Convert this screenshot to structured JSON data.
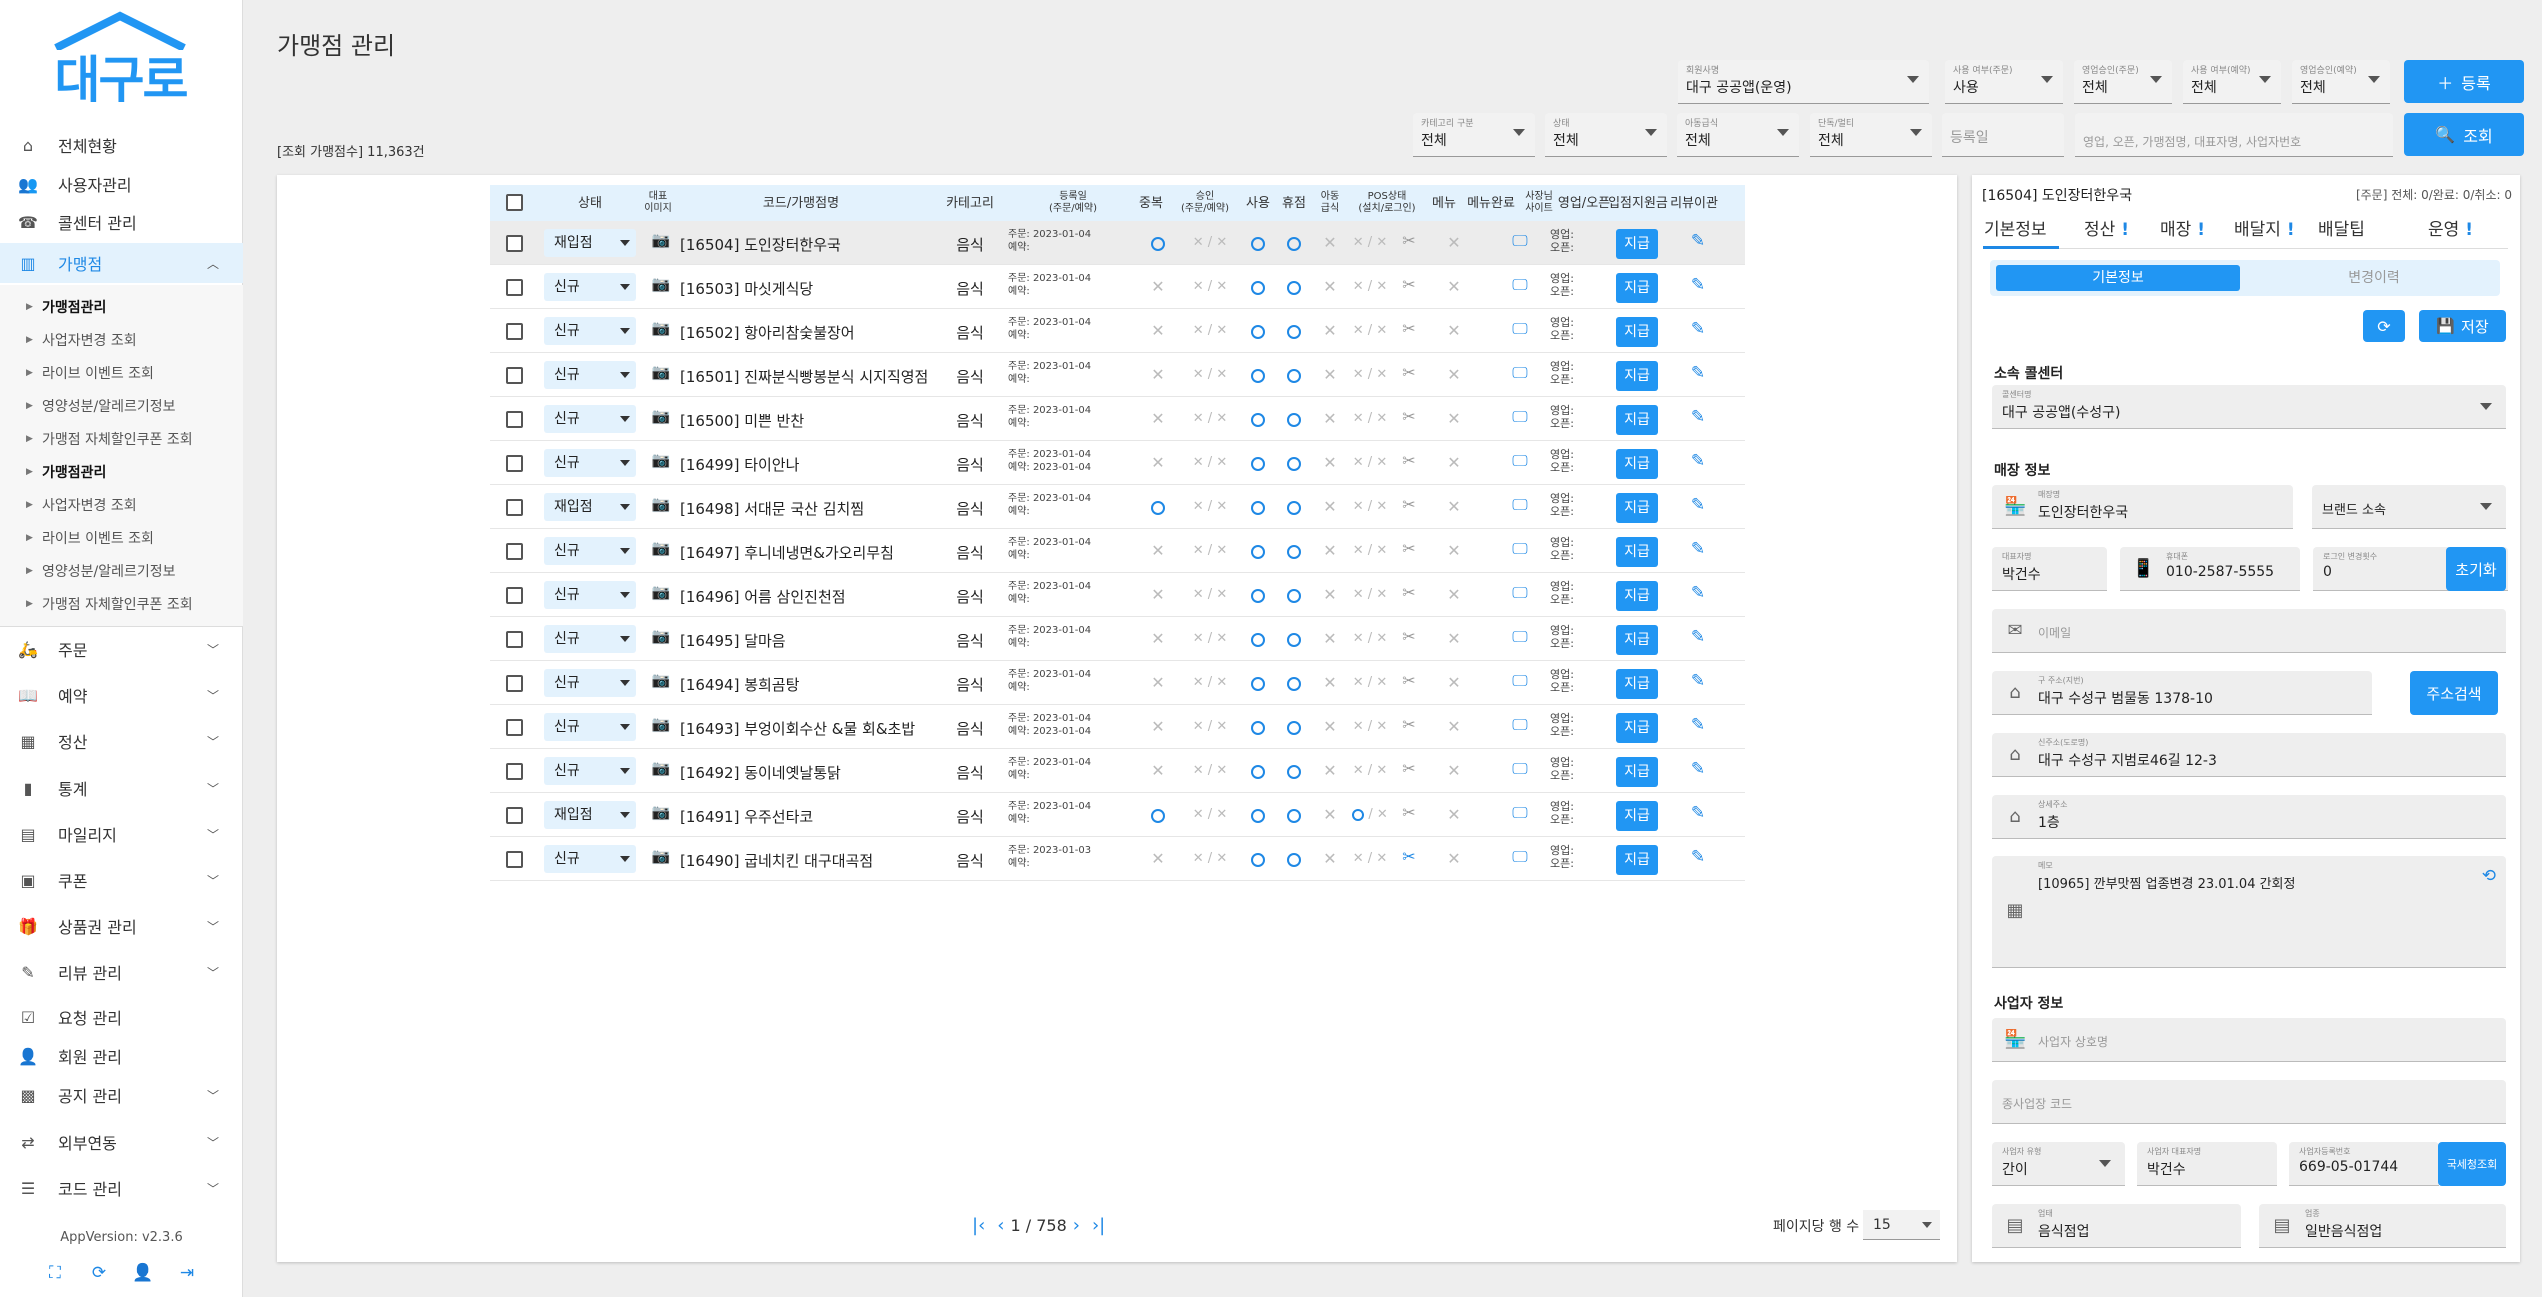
{
  "brand": {
    "logo_text": "대구로"
  },
  "sidebar": {
    "items": [
      {
        "label": "전체현황",
        "icon": "home-icon"
      },
      {
        "label": "사용자관리",
        "icon": "users-icon"
      },
      {
        "label": "콜센터 관리",
        "icon": "headset-icon"
      },
      {
        "label": "가맹점",
        "icon": "store-icon"
      },
      {
        "label": "주문",
        "icon": "order-icon"
      },
      {
        "label": "예약",
        "icon": "book-icon"
      },
      {
        "label": "정산",
        "icon": "calc-icon"
      },
      {
        "label": "통계",
        "icon": "chart-icon"
      },
      {
        "label": "마일리지",
        "icon": "mileage-icon"
      },
      {
        "label": "쿠폰",
        "icon": "coupon-icon"
      },
      {
        "label": "상품권 관리",
        "icon": "gift-icon"
      },
      {
        "label": "리뷰 관리",
        "icon": "review-icon"
      },
      {
        "label": "요청 관리",
        "icon": "request-icon"
      },
      {
        "label": "회원 관리",
        "icon": "member-icon"
      },
      {
        "label": "공지 관리",
        "icon": "notice-icon"
      },
      {
        "label": "외부연동",
        "icon": "link-icon"
      },
      {
        "label": "코드 관리",
        "icon": "code-icon"
      }
    ],
    "sub": [
      "가맹점관리",
      "사업자변경 조회",
      "라이브 이벤트 조회",
      "영양성분/알레르기정보",
      "가맹점 자체할인쿠폰 조회",
      "가맹점관리",
      "사업자변경 조회",
      "라이브 이벤트 조회",
      "영양성분/알레르기정보",
      "가맹점 자체할인쿠폰 조회"
    ],
    "version": "AppVersion: v2.3.6"
  },
  "header": {
    "title": "가맹점 관리",
    "count_label": "[조회 가맹점수] 11,363건"
  },
  "filters": {
    "callcenter": {
      "label": "회원사명",
      "value": "대구 공공앱(운영)"
    },
    "use_order": {
      "label": "사용 여부(주문)",
      "value": "사용"
    },
    "sales_order": {
      "label": "영업승인(주문)",
      "value": "전체"
    },
    "use_reserve": {
      "label": "사용 여부(예약)",
      "value": "전체"
    },
    "sales_reserve": {
      "label": "영업승인(예약)",
      "value": "전체"
    },
    "register_btn": "등록",
    "category": {
      "label": "카테고리 구분",
      "value": "전체"
    },
    "status": {
      "label": "상태",
      "value": "전체"
    },
    "child_meal": {
      "label": "아동급식",
      "value": "전체"
    },
    "group": {
      "label": "단독/멀티",
      "value": "전체"
    },
    "reg_date": {
      "placeholder": "등록일"
    },
    "keyword": {
      "placeholder": "영업, 오픈, 가맹점명, 대표자명, 사업자번호"
    },
    "search_btn": "조회"
  },
  "table": {
    "headers": [
      "상태",
      "대표\n이미지",
      "코드/가맹점명",
      "카테고리",
      "등록일\n(주문/예약)",
      "중복",
      "승인\n(주문/예약)",
      "사용",
      "휴점",
      "아동\n급식",
      "POS상태\n(설치/로그인)",
      "메뉴",
      "메뉴완료",
      "사장님\n사이트",
      "영업/오픈",
      "입점지원금",
      "리뷰이관"
    ],
    "rows": [
      {
        "status": "재입점",
        "name": "[16504] 도인장터한우국",
        "cat": "음식",
        "d1": "주문: 2023-01-04",
        "d2": "예약:",
        "dup": true,
        "pos": "x"
      },
      {
        "status": "신규",
        "name": "[16503] 마싯게식당",
        "cat": "음식",
        "d1": "주문: 2023-01-04",
        "d2": "예약:",
        "dup": false,
        "pos": "x"
      },
      {
        "status": "신규",
        "name": "[16502] 항아리참숯불장어",
        "cat": "음식",
        "d1": "주문: 2023-01-04",
        "d2": "예약:",
        "dup": false,
        "pos": "x"
      },
      {
        "status": "신규",
        "name": "[16501] 진짜분식빵봉분식 시지직영점",
        "cat": "음식",
        "d1": "주문: 2023-01-04",
        "d2": "예약:",
        "dup": false,
        "pos": "x"
      },
      {
        "status": "신규",
        "name": "[16500] 미쁜 반찬",
        "cat": "음식",
        "d1": "주문: 2023-01-04",
        "d2": "예약:",
        "dup": false,
        "pos": "x"
      },
      {
        "status": "신규",
        "name": "[16499] 타이안나",
        "cat": "음식",
        "d1": "주문: 2023-01-04",
        "d2": "예약: 2023-01-04",
        "dup": false,
        "pos": "x"
      },
      {
        "status": "재입점",
        "name": "[16498] 서대문 국산 김치찜",
        "cat": "음식",
        "d1": "주문: 2023-01-04",
        "d2": "예약:",
        "dup": true,
        "pos": "x"
      },
      {
        "status": "신규",
        "name": "[16497] 후니네냉면&가오리무침",
        "cat": "음식",
        "d1": "주문: 2023-01-04",
        "d2": "예약:",
        "dup": false,
        "pos": "x"
      },
      {
        "status": "신규",
        "name": "[16496] 어름 삼인진천점",
        "cat": "음식",
        "d1": "주문: 2023-01-04",
        "d2": "예약:",
        "dup": false,
        "pos": "x"
      },
      {
        "status": "신규",
        "name": "[16495] 달마음",
        "cat": "음식",
        "d1": "주문: 2023-01-04",
        "d2": "예약:",
        "dup": false,
        "pos": "x"
      },
      {
        "status": "신규",
        "name": "[16494] 봉희곰탕",
        "cat": "음식",
        "d1": "주문: 2023-01-04",
        "d2": "예약:",
        "dup": false,
        "pos": "x"
      },
      {
        "status": "신규",
        "name": "[16493] 부엉이회수산 &물 회&초밥",
        "cat": "음식",
        "d1": "주문: 2023-01-04",
        "d2": "예약: 2023-01-04",
        "dup": false,
        "pos": "x"
      },
      {
        "status": "신규",
        "name": "[16492] 동이네옛날통닭",
        "cat": "음식",
        "d1": "주문: 2023-01-04",
        "d2": "예약:",
        "dup": false,
        "pos": "x"
      },
      {
        "status": "재입점",
        "name": "[16491] 우주선타코",
        "cat": "음식",
        "d1": "주문: 2023-01-04",
        "d2": "예약:",
        "dup": true,
        "pos": "o"
      },
      {
        "status": "신규",
        "name": "[16490] 굽네치킨 대구대곡점",
        "cat": "음식",
        "d1": "주문: 2023-01-03",
        "d2": "예약:",
        "dup": false,
        "pos": "x",
        "menu_done": true
      }
    ],
    "cell_labels": {
      "x": "✕",
      "slash": "✕ / ✕",
      "biz_a": "영업:",
      "biz_b": "오픈:",
      "support_btn": "지급"
    }
  },
  "pager": {
    "text": "1 / 758",
    "rows_per_page_label": "페이지당 행 수 :",
    "rows_per_page": "15"
  },
  "detail": {
    "title": "[16504] 도인장터한우국",
    "summary": "[주문] 전체: 0/완료: 0/취소: 0",
    "tabs": [
      "기본정보",
      "정산",
      "매장",
      "배달지",
      "배달팁",
      "운영"
    ],
    "tab_marks": [
      "",
      "!",
      "!",
      "!",
      "",
      "!"
    ],
    "seg_on": "기본정보",
    "seg_off": "변경이력",
    "save_btn": "저장",
    "sec_center": "소속 콜센터",
    "center": {
      "label": "콜센터명",
      "value": "대구 공공앱(수성구)"
    },
    "sec_store": "매장 정보",
    "store_name": {
      "label": "매장명",
      "value": "도인장터한우국"
    },
    "brand": {
      "value": "브랜드 소속"
    },
    "owner": {
      "label": "대표자명",
      "value": "박건수"
    },
    "phone": {
      "label": "휴대폰",
      "value": "010-2587-5555"
    },
    "pw_count": {
      "label": "로그인 변경횟수",
      "value": "0"
    },
    "init_btn": "초기화",
    "email": {
      "placeholder": "이메일"
    },
    "addr_old": {
      "label": "구 주소(지번)",
      "value": "대구 수성구 범물동 1378-10"
    },
    "addr_btn": "주소검색",
    "addr_new": {
      "label": "신주소(도로명)",
      "value": "대구 수성구 지범로46길 12-3"
    },
    "addr_detail": {
      "label": "상세주소",
      "value": "1층"
    },
    "memo": {
      "label": "메모",
      "value": "[10965] 깐부맛찜 업종변경 23.01.04 간회정"
    },
    "sec_biz": "사업자 정보",
    "biz_name": {
      "placeholder": "사업자 상호명"
    },
    "biz_code": {
      "placeholder": "종사업장 코드"
    },
    "biz_type": {
      "label": "사업자 유형",
      "value": "간이"
    },
    "biz_owner": {
      "label": "사업자 대표자명",
      "value": "박건수"
    },
    "biz_no": {
      "label": "사업자등록번호",
      "value": "669-05-01744"
    },
    "tax_btn": "국세청조회",
    "biz_kind": {
      "label": "업태",
      "value": "음식점업"
    },
    "biz_item": {
      "label": "업종",
      "value": "일반음식점업"
    }
  }
}
